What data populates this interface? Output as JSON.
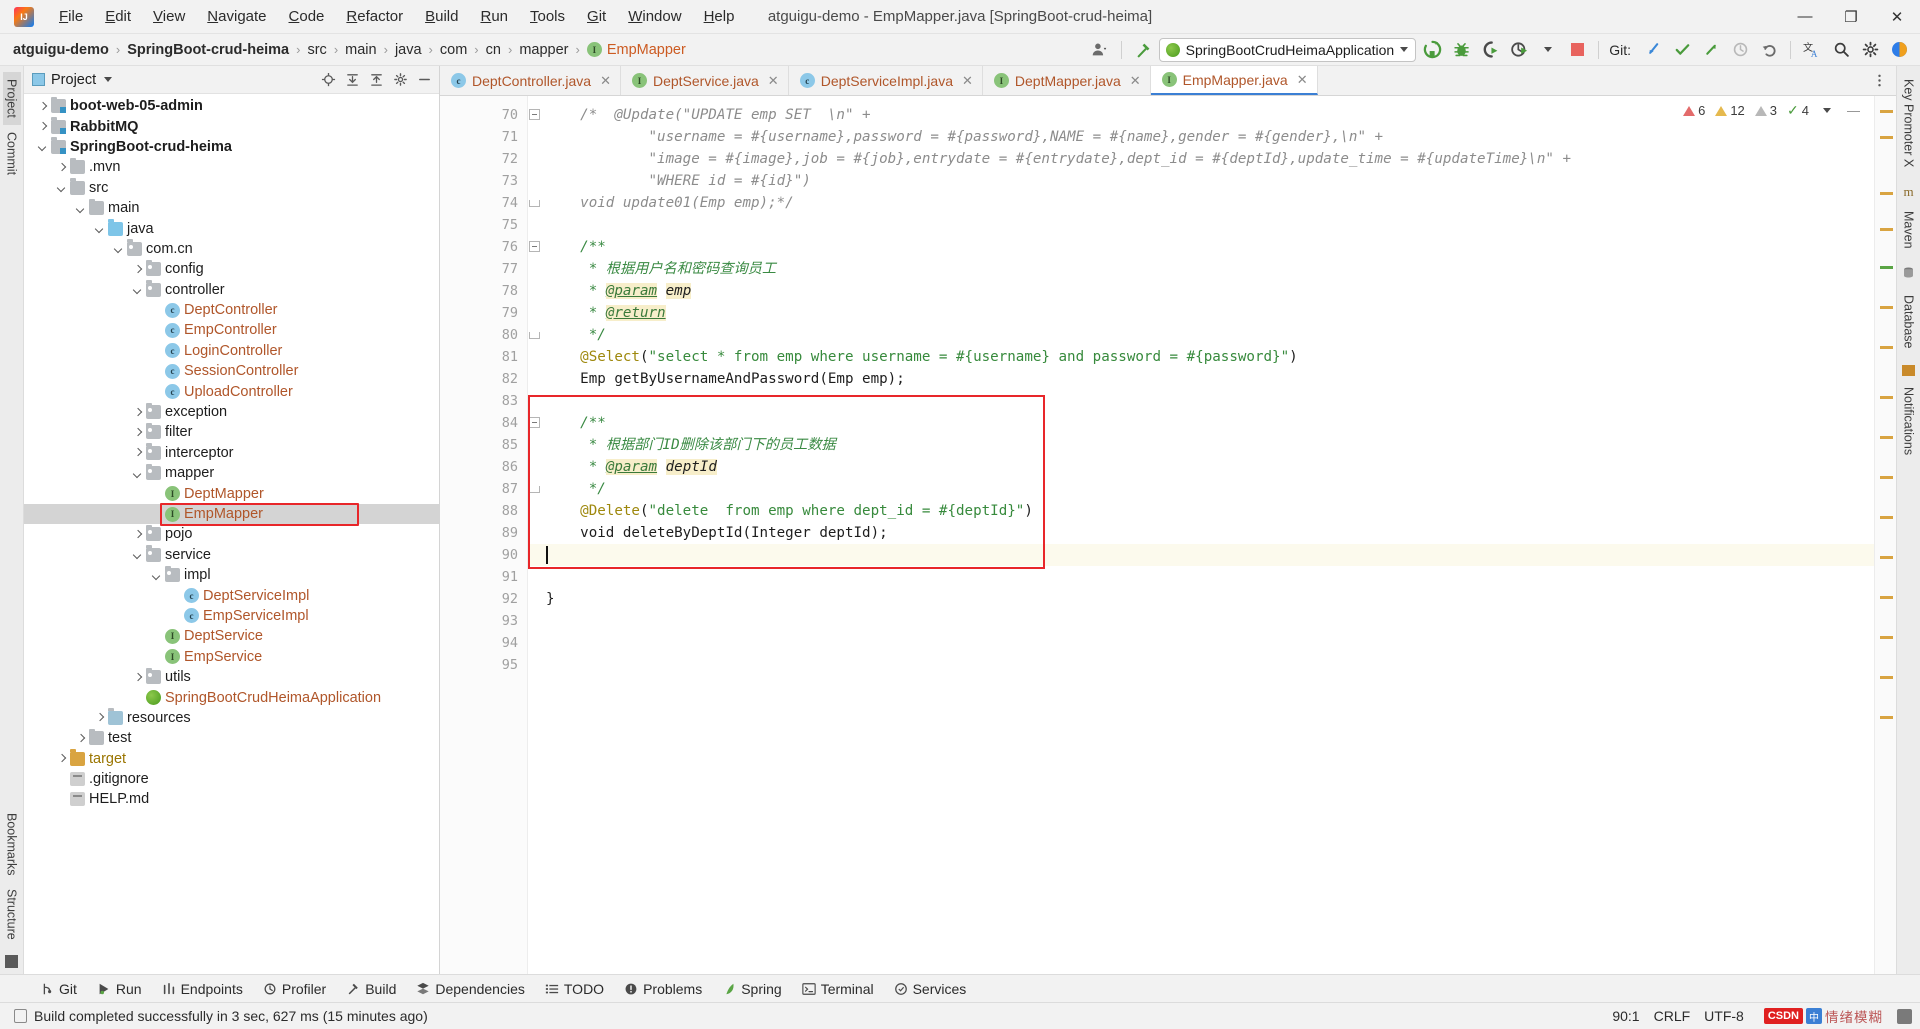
{
  "window": {
    "title": "atguigu-demo - EmpMapper.java [SpringBoot-crud-heima]",
    "minimize": "—",
    "maximize": "❐",
    "close": "✕"
  },
  "menubar": {
    "items": [
      {
        "label": "File",
        "mnemonic": "F"
      },
      {
        "label": "Edit",
        "mnemonic": "E"
      },
      {
        "label": "View",
        "mnemonic": "V"
      },
      {
        "label": "Navigate",
        "mnemonic": "N"
      },
      {
        "label": "Code",
        "mnemonic": "C"
      },
      {
        "label": "Refactor",
        "mnemonic": "R"
      },
      {
        "label": "Build",
        "mnemonic": "B"
      },
      {
        "label": "Run",
        "mnemonic": "R"
      },
      {
        "label": "Tools",
        "mnemonic": "T"
      },
      {
        "label": "Git",
        "mnemonic": "G"
      },
      {
        "label": "Window",
        "mnemonic": "W"
      },
      {
        "label": "Help",
        "mnemonic": "H"
      }
    ]
  },
  "breadcrumb": {
    "items": [
      "atguigu-demo",
      "SpringBoot-crud-heima",
      "src",
      "main",
      "java",
      "com",
      "cn",
      "mapper"
    ],
    "file": "EmpMapper",
    "separator": "›"
  },
  "toolbar": {
    "run_config": "SpringBootCrudHeimaApplication",
    "git_label": "Git:",
    "buttons": [
      "run-button",
      "debug-button",
      "run-with-coverage-button",
      "profiler-button",
      "stop-button"
    ],
    "git_buttons": [
      "update-project-icon",
      "commit-icon",
      "push-icon",
      "history-icon",
      "rollback-icon"
    ],
    "right_buttons": [
      "translate-icon",
      "search-everywhere-icon",
      "settings-icon",
      "ide-assistant-icon"
    ]
  },
  "left_strip": {
    "top": [
      "Project",
      "Commit"
    ],
    "bottom": [
      "Bookmarks",
      "Structure"
    ]
  },
  "right_strip": {
    "items": [
      "Key Promoter X",
      "Maven",
      "Database",
      "Notifications"
    ]
  },
  "project_panel": {
    "title": "Project",
    "icons": [
      "locate-icon",
      "collapse-all-icon",
      "expand-icon",
      "settings-icon",
      "hide-icon"
    ],
    "tree": [
      {
        "label": "boot-web-05-admin",
        "indent": 0,
        "arrow": "right",
        "icon": "module",
        "bold": true
      },
      {
        "label": "RabbitMQ",
        "indent": 0,
        "arrow": "right",
        "icon": "module",
        "bold": true
      },
      {
        "label": "SpringBoot-crud-heima",
        "indent": 0,
        "arrow": "down",
        "icon": "module",
        "bold": true
      },
      {
        "label": ".mvn",
        "indent": 1,
        "arrow": "right",
        "icon": "folder"
      },
      {
        "label": "src",
        "indent": 1,
        "arrow": "down",
        "icon": "folder"
      },
      {
        "label": "main",
        "indent": 2,
        "arrow": "down",
        "icon": "folder"
      },
      {
        "label": "java",
        "indent": 3,
        "arrow": "down",
        "icon": "source-folder"
      },
      {
        "label": "com.cn",
        "indent": 4,
        "arrow": "down",
        "icon": "package"
      },
      {
        "label": "config",
        "indent": 5,
        "arrow": "right",
        "icon": "package"
      },
      {
        "label": "controller",
        "indent": 5,
        "arrow": "down",
        "icon": "package"
      },
      {
        "label": "DeptController",
        "indent": 6,
        "arrow": "none",
        "icon": "class",
        "orange": true
      },
      {
        "label": "EmpController",
        "indent": 6,
        "arrow": "none",
        "icon": "class",
        "orange": true
      },
      {
        "label": "LoginController",
        "indent": 6,
        "arrow": "none",
        "icon": "class",
        "orange": true
      },
      {
        "label": "SessionController",
        "indent": 6,
        "arrow": "none",
        "icon": "class",
        "orange": true
      },
      {
        "label": "UploadController",
        "indent": 6,
        "arrow": "none",
        "icon": "class",
        "orange": true
      },
      {
        "label": "exception",
        "indent": 5,
        "arrow": "right",
        "icon": "package"
      },
      {
        "label": "filter",
        "indent": 5,
        "arrow": "right",
        "icon": "package"
      },
      {
        "label": "interceptor",
        "indent": 5,
        "arrow": "right",
        "icon": "package"
      },
      {
        "label": "mapper",
        "indent": 5,
        "arrow": "down",
        "icon": "package"
      },
      {
        "label": "DeptMapper",
        "indent": 6,
        "arrow": "none",
        "icon": "interface",
        "orange": true
      },
      {
        "label": "EmpMapper",
        "indent": 6,
        "arrow": "none",
        "icon": "interface",
        "orange": true,
        "selected": true,
        "highlighted": true
      },
      {
        "label": "pojo",
        "indent": 5,
        "arrow": "right",
        "icon": "package"
      },
      {
        "label": "service",
        "indent": 5,
        "arrow": "down",
        "icon": "package"
      },
      {
        "label": "impl",
        "indent": 6,
        "arrow": "down",
        "icon": "package"
      },
      {
        "label": "DeptServiceImpl",
        "indent": 7,
        "arrow": "none",
        "icon": "class",
        "orange": true
      },
      {
        "label": "EmpServiceImpl",
        "indent": 7,
        "arrow": "none",
        "icon": "class",
        "orange": true
      },
      {
        "label": "DeptService",
        "indent": 6,
        "arrow": "none",
        "icon": "interface",
        "orange": true
      },
      {
        "label": "EmpService",
        "indent": 6,
        "arrow": "none",
        "icon": "interface",
        "orange": true
      },
      {
        "label": "utils",
        "indent": 5,
        "arrow": "right",
        "icon": "package"
      },
      {
        "label": "SpringBootCrudHeimaApplication",
        "indent": 5,
        "arrow": "none",
        "icon": "spring",
        "orange": true
      },
      {
        "label": "resources",
        "indent": 3,
        "arrow": "right",
        "icon": "resource-folder"
      },
      {
        "label": "test",
        "indent": 2,
        "arrow": "right",
        "icon": "folder"
      },
      {
        "label": "target",
        "indent": 1,
        "arrow": "right",
        "icon": "target-folder",
        "target": true
      },
      {
        "label": ".gitignore",
        "indent": 1,
        "arrow": "none",
        "icon": "file"
      },
      {
        "label": "HELP.md",
        "indent": 1,
        "arrow": "none",
        "icon": "file"
      }
    ]
  },
  "editor_tabs": [
    {
      "label": "DeptController.java",
      "icon": "class",
      "active": false
    },
    {
      "label": "DeptService.java",
      "icon": "interface",
      "active": false
    },
    {
      "label": "DeptServiceImpl.java",
      "icon": "class",
      "active": false
    },
    {
      "label": "DeptMapper.java",
      "icon": "interface",
      "active": false
    },
    {
      "label": "EmpMapper.java",
      "icon": "interface",
      "active": true
    }
  ],
  "inspection": {
    "errors": "6",
    "warnings": "12",
    "weak_warnings": "3",
    "typos": "4",
    "ok_icon": "checkmark-icon"
  },
  "editor": {
    "first_line": 70,
    "lines": [
      {
        "n": 70,
        "fold": "minus",
        "html": "    <span class='cmt'>/*  @Update(\"UPDATE emp SET  \\n\" +</span>"
      },
      {
        "n": 71,
        "html": "            <span class='cmt'>\"username = #{username},password = #{password},NAME = #{name},gender = #{gender},\\n\" +</span>"
      },
      {
        "n": 72,
        "html": "            <span class='cmt'>\"image = #{image},job = #{job},entrydate = #{entrydate},dept_id = #{deptId},update_time = #{updateTime}\\n\" +</span>"
      },
      {
        "n": 73,
        "html": "            <span class='cmt'>\"WHERE id = #{id}\")</span>"
      },
      {
        "n": 74,
        "fold": "end",
        "html": "    <span class='cmt'>void update01(Emp emp);*/</span>"
      },
      {
        "n": 75,
        "html": ""
      },
      {
        "n": 76,
        "fold": "minus",
        "html": "    <span class='cmt-gr'>/**</span>"
      },
      {
        "n": 77,
        "html": "     <span class='cmt-gr'>* 根据用户名和密码查询员工</span>"
      },
      {
        "n": 78,
        "html": "     <span class='cmt-gr'>* </span><span class='tag'>@param</span> <span class='tagv'>emp</span>"
      },
      {
        "n": 79,
        "html": "     <span class='cmt-gr'>* </span><span class='tag'>@return</span>"
      },
      {
        "n": 80,
        "fold": "end",
        "html": "     <span class='cmt-gr'>*/</span>"
      },
      {
        "n": 81,
        "html": "    <span class='anno'>@Select</span>(<span class='str'>\"select * from emp where username = #{username} and password = #{password}\"</span>)"
      },
      {
        "n": 82,
        "html": "    Emp getByUsernameAndPassword(Emp emp);"
      },
      {
        "n": 83,
        "html": ""
      },
      {
        "n": 84,
        "fold": "minus",
        "html": "    <span class='cmt-gr'>/**</span>"
      },
      {
        "n": 85,
        "html": "     <span class='cmt-gr'>* 根据部门ID删除该部门下的员工数据</span>"
      },
      {
        "n": 86,
        "html": "     <span class='cmt-gr'>* </span><span class='tag'>@param</span> <span class='tagv'>deptId</span>"
      },
      {
        "n": 87,
        "fold": "end",
        "html": "     <span class='cmt-gr'>*/</span>"
      },
      {
        "n": 88,
        "html": "    <span class='anno'>@Delete</span>(<span class='str'>\"delete  from emp where dept_id = #{deptId}\"</span>)"
      },
      {
        "n": 89,
        "html": "    void deleteByDeptId(Integer deptId);"
      },
      {
        "n": 90,
        "current": true,
        "html": ""
      },
      {
        "n": 91,
        "html": ""
      },
      {
        "n": 92,
        "html": "}"
      },
      {
        "n": 93,
        "html": ""
      },
      {
        "n": 94,
        "html": ""
      },
      {
        "n": 95,
        "html": ""
      }
    ]
  },
  "bottom_bar": {
    "items": [
      {
        "label": "Git",
        "icon": "git-branch-icon"
      },
      {
        "label": "Run",
        "icon": "run-icon"
      },
      {
        "label": "Endpoints",
        "icon": "endpoints-icon"
      },
      {
        "label": "Profiler",
        "icon": "profiler-icon"
      },
      {
        "label": "Build",
        "icon": "build-hammer-icon"
      },
      {
        "label": "Dependencies",
        "icon": "dependencies-icon"
      },
      {
        "label": "TODO",
        "icon": "todo-list-icon"
      },
      {
        "label": "Problems",
        "icon": "problems-icon"
      },
      {
        "label": "Spring",
        "icon": "spring-leaf-icon"
      },
      {
        "label": "Terminal",
        "icon": "terminal-icon"
      },
      {
        "label": "Services",
        "icon": "services-icon"
      }
    ]
  },
  "status_bar": {
    "message": "Build completed successfully in 3 sec, 627 ms (15 minutes ago)",
    "caret_position": "90:1",
    "line_separator": "CRLF",
    "encoding": "UTF-8",
    "ime": "中",
    "watermark": "情绪模糊",
    "csdn": "CSDN"
  },
  "colors": {
    "accent_blue": "#3b7fd4",
    "red_highlight": "#e8262a",
    "orange_file": "#b0562a",
    "green_string": "#378a3c",
    "annotation_gold": "#9e880d",
    "selection_gray": "#d4d4d4"
  }
}
